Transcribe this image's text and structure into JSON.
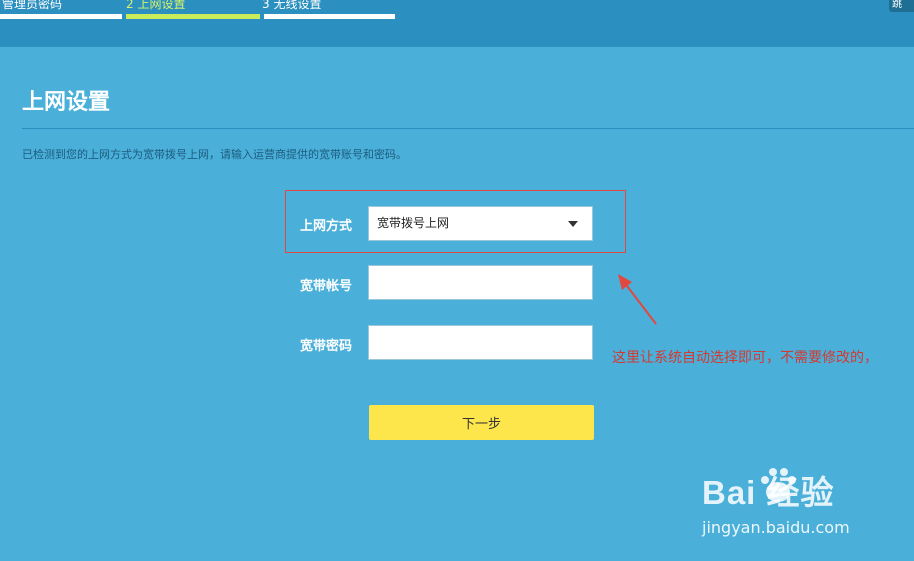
{
  "steps": [
    {
      "label": "管理员密码",
      "active": false
    },
    {
      "label": "2 上网设置",
      "active": true
    },
    {
      "label": "3 无线设置",
      "active": false
    }
  ],
  "corner_button": "跳",
  "page_title": "上网设置",
  "description": "已检测到您的上网方式为宽带拨号上网，请输入运营商提供的宽带账号和密码。",
  "form": {
    "connection_type_label": "上网方式",
    "connection_type_value": "宽带拨号上网",
    "account_label": "宽带帐号",
    "account_value": "",
    "password_label": "宽带密码",
    "password_value": "",
    "next_label": "下一步"
  },
  "annotation": "这里让系统自动选择即可，不需要修改的，",
  "watermark": {
    "logo": "Bai  经验",
    "url": "jingyan.baidu.com"
  },
  "colors": {
    "background": "#4aafd9",
    "header": "#2b8fbf",
    "active_step": "#c9ec5a",
    "button": "#fde54c",
    "annotation": "#d33a31"
  }
}
